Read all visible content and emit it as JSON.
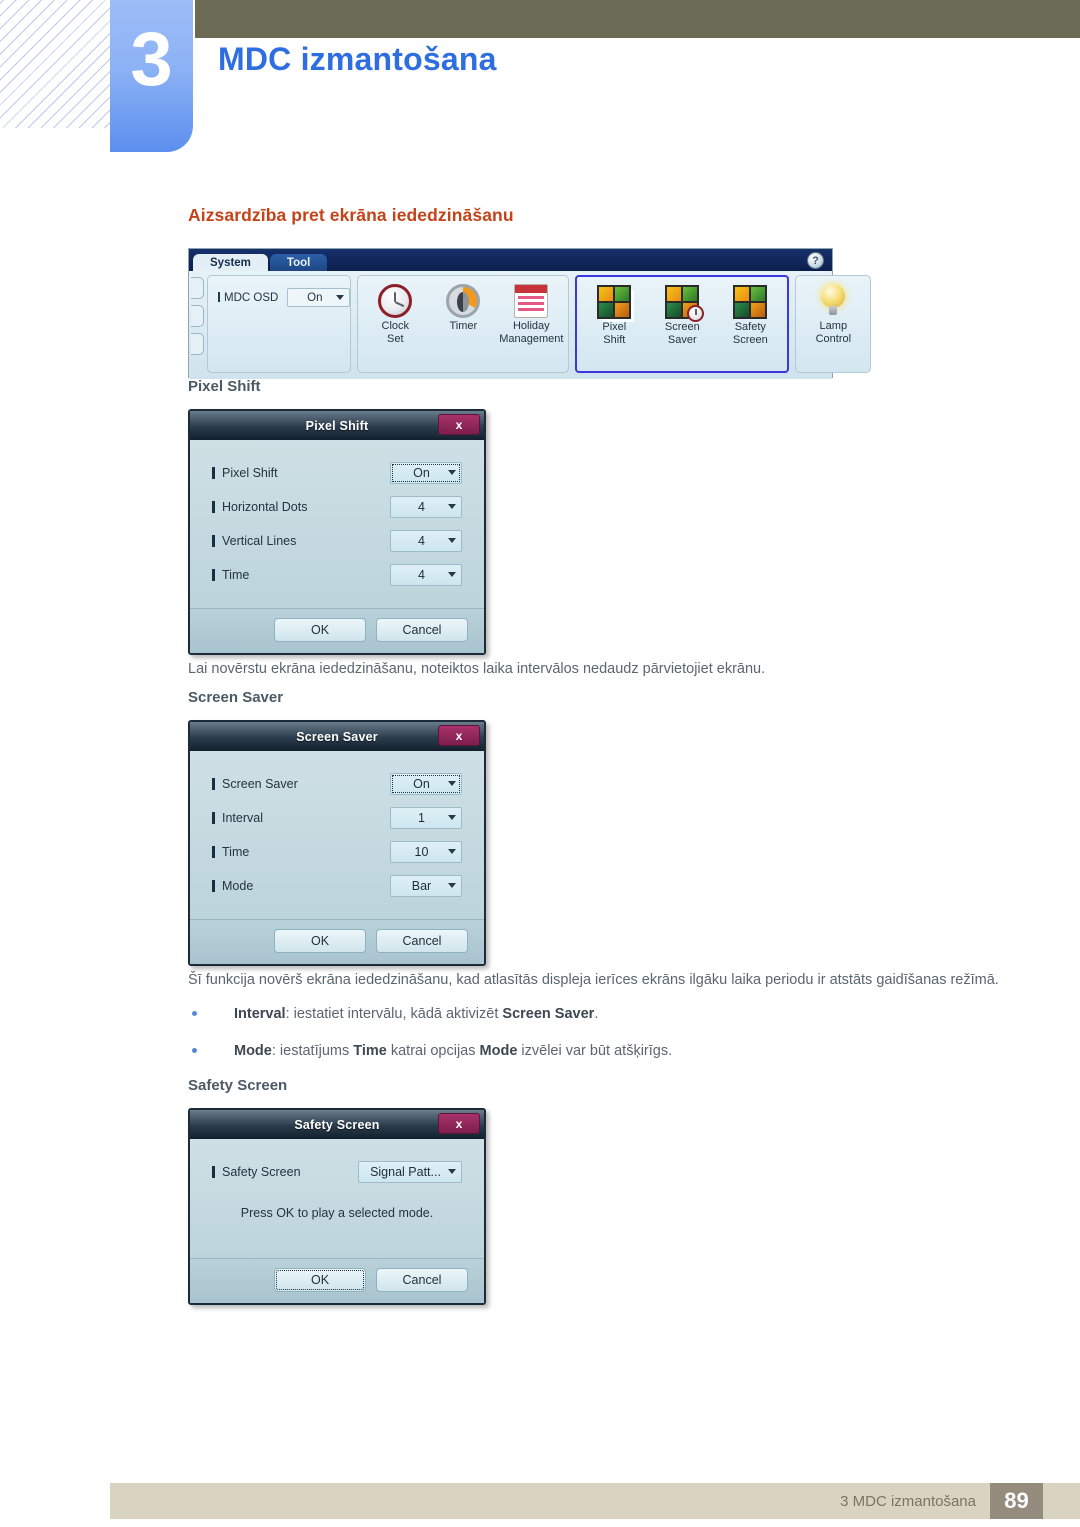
{
  "header": {
    "chapter_number": "3",
    "chapter_title": "MDC izmantošana"
  },
  "section": {
    "heading": "Aizsardzība pret ekrāna iededzināšanu"
  },
  "toolbar": {
    "tabs": [
      {
        "label": "System",
        "active": true
      },
      {
        "label": "Tool",
        "active": false
      }
    ],
    "help_icon": "?",
    "osd": {
      "label": "MDC OSD",
      "value": "On"
    },
    "items": [
      {
        "line1": "Clock",
        "line2": "Set",
        "icon": "clock-icon"
      },
      {
        "line1": "Timer",
        "line2": "",
        "icon": "timer-icon"
      },
      {
        "line1": "Holiday",
        "line2": "Management",
        "icon": "calendar-icon"
      },
      {
        "line1": "Pixel",
        "line2": "Shift",
        "icon": "pixel-shift-icon"
      },
      {
        "line1": "Screen",
        "line2": "Saver",
        "icon": "screen-saver-icon"
      },
      {
        "line1": "Safety",
        "line2": "Screen",
        "icon": "safety-screen-icon"
      },
      {
        "line1": "Lamp",
        "line2": "Control",
        "icon": "lamp-icon"
      }
    ]
  },
  "pixel_shift": {
    "sub_heading": "Pixel Shift",
    "dialog": {
      "title": "Pixel Shift",
      "close_label": "x",
      "rows": [
        {
          "label": "Pixel Shift",
          "value": "On"
        },
        {
          "label": "Horizontal Dots",
          "value": "4"
        },
        {
          "label": "Vertical Lines",
          "value": "4"
        },
        {
          "label": "Time",
          "value": "4"
        }
      ],
      "ok_label": "OK",
      "cancel_label": "Cancel"
    },
    "paragraph": "Lai novērstu ekrāna iededzināšanu, noteiktos laika intervālos nedaudz pārvietojiet ekrānu."
  },
  "screen_saver": {
    "sub_heading": "Screen Saver",
    "dialog": {
      "title": "Screen Saver",
      "close_label": "x",
      "rows": [
        {
          "label": "Screen Saver",
          "value": "On"
        },
        {
          "label": "Interval",
          "value": "1"
        },
        {
          "label": "Time",
          "value": "10"
        },
        {
          "label": "Mode",
          "value": "Bar"
        }
      ],
      "ok_label": "OK",
      "cancel_label": "Cancel"
    },
    "paragraph": "Šī funkcija novērš ekrāna iededzināšanu, kad atlasītās displeja ierīces ekrāns ilgāku laika periodu ir atstāts gaidīšanas režīmā.",
    "bullets": [
      {
        "parts": [
          {
            "text": "Interval",
            "bold": true
          },
          {
            "text": ": iestatiet intervālu, kādā aktivizēt ",
            "bold": false
          },
          {
            "text": "Screen Saver",
            "bold": true
          },
          {
            "text": ".",
            "bold": false
          }
        ]
      },
      {
        "parts": [
          {
            "text": "Mode",
            "bold": true
          },
          {
            "text": ": iestatījums ",
            "bold": false
          },
          {
            "text": "Time",
            "bold": true
          },
          {
            "text": " katrai opcijas ",
            "bold": false
          },
          {
            "text": "Mode",
            "bold": true
          },
          {
            "text": " izvēlei var būt atšķirīgs.",
            "bold": false
          }
        ]
      }
    ]
  },
  "safety_screen": {
    "sub_heading": "Safety Screen",
    "dialog": {
      "title": "Safety Screen",
      "close_label": "x",
      "rows": [
        {
          "label": "Safety Screen",
          "value": "Signal Patt..."
        }
      ],
      "note": "Press OK to play a selected mode.",
      "ok_label": "OK",
      "cancel_label": "Cancel"
    }
  },
  "footer": {
    "text": "3 MDC izmantošana",
    "page": "89"
  },
  "colors": {
    "accent_red": "#c4441a",
    "chapter_blue": "#2f6ee0",
    "header_olive": "#6b6a55",
    "footer_beige": "#d9d3c1",
    "page_badge": "#968c7d",
    "selection_blue": "#3b38e0"
  }
}
